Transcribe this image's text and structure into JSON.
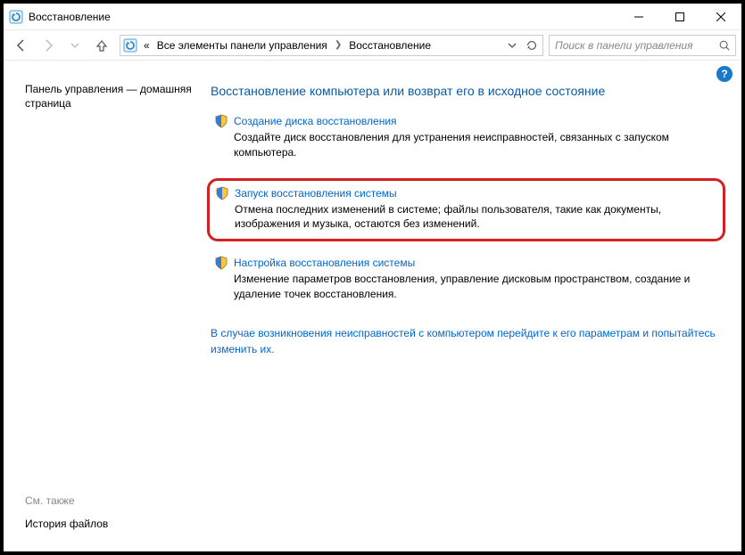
{
  "window": {
    "title": "Восстановление"
  },
  "breadcrumb": {
    "prefix": "«",
    "item1": "Все элементы панели управления",
    "item2": "Восстановление"
  },
  "search": {
    "placeholder": "Поиск в панели управления"
  },
  "sidebar": {
    "home": "Панель управления — домашняя страница",
    "see_also": "См. также",
    "history": "История файлов"
  },
  "main": {
    "title": "Восстановление компьютера или возврат его в исходное состояние",
    "items": [
      {
        "label": "Создание диска восстановления",
        "desc": "Создайте диск восстановления для устранения неисправностей, связанных с запуском компьютера."
      },
      {
        "label": "Запуск восстановления системы",
        "desc": "Отмена последних изменений в системе; файлы пользователя, такие как документы, изображения и музыка, остаются без изменений."
      },
      {
        "label": "Настройка восстановления системы",
        "desc": "Изменение параметров восстановления, управление дисковым пространством, создание и удаление точек восстановления."
      }
    ],
    "bottom_link": "В случае возникновения неисправностей с компьютером перейдите к его параметрам и попытайтесь изменить их."
  }
}
